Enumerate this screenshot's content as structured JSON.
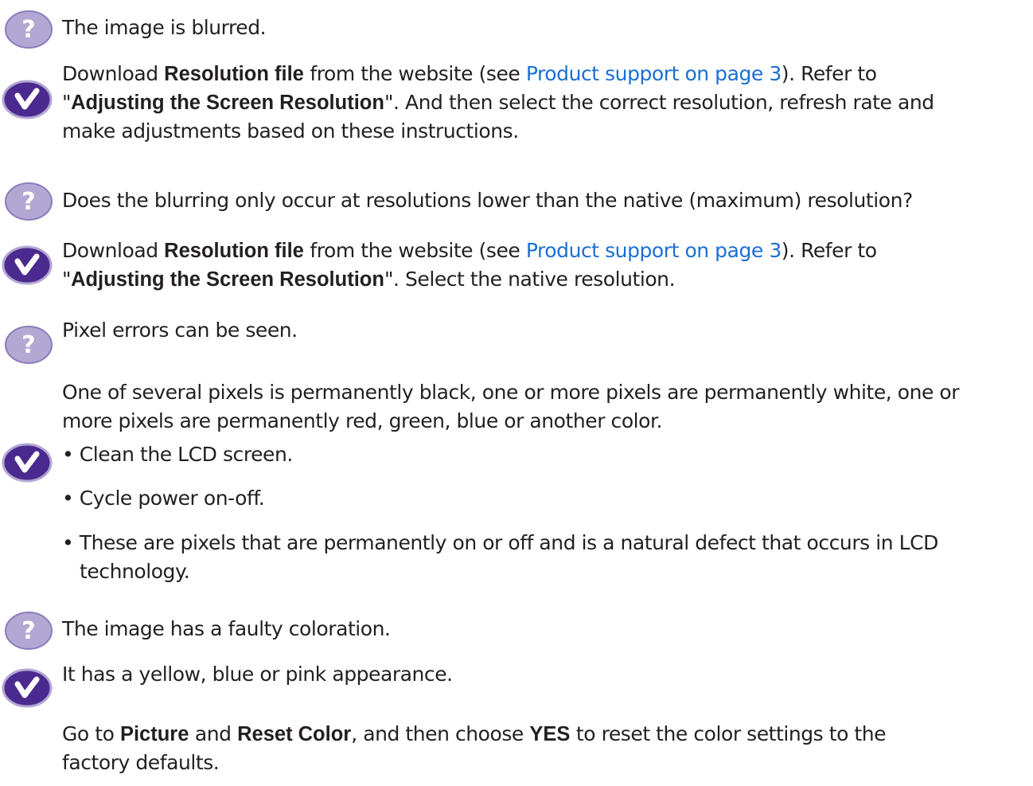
{
  "colors": {
    "question_icon_fill": "#b3a7d3",
    "question_icon_ring": "#8c7cbc",
    "check_icon_fill": "#4b2a8f",
    "check_icon_ring": "#b3a7d3",
    "link": "#1a6fd4",
    "text": "#231f20"
  },
  "icons": {
    "question": "question-mark-icon",
    "answer": "check-mark-icon"
  },
  "faq": {
    "q1": {
      "text": "The image is blurred."
    },
    "a1": {
      "t1": "Download ",
      "b1": "Resolution file",
      "t2": " from the website (see ",
      "link": "Product support on page 3",
      "t3": "). Refer to",
      "t4": "\"",
      "b2": "Adjusting the Screen Resolution",
      "t5": "\". And then select the correct resolution, refresh rate and",
      "t6": "make adjustments based on these instructions."
    },
    "q2": {
      "text": "Does the blurring only occur at resolutions lower than the native (maximum) resolution?"
    },
    "a2": {
      "t1": "Download ",
      "b1": "Resolution file",
      "t2": " from the website (see ",
      "link": "Product support on page 3",
      "t3": "). Refer to",
      "t4": "\"",
      "b2": "Adjusting the Screen Resolution",
      "t5": "\". Select the native resolution."
    },
    "q3": {
      "text": "Pixel errors can be seen."
    },
    "a3": {
      "intro_line1": "One of several pixels is permanently black, one or more pixels are permanently white, one or",
      "intro_line2": "more pixels are permanently red, green, blue or another color.",
      "bullet1": "• Clean the LCD screen.",
      "bullet2": "• Cycle power on-off.",
      "bullet3_line1": "• These are pixels that are permanently on or off and is a natural defect that occurs in LCD",
      "bullet3_line2": "technology."
    },
    "q4": {
      "text": "The image has a faulty coloration."
    },
    "a4": {
      "line1": "It has a yellow, blue or pink appearance.",
      "t1": "Go to ",
      "b1": "Picture",
      "t2": " and ",
      "b2": "Reset Color",
      "t3": ", and then choose ",
      "b3": "YES",
      "t4": " to reset the color settings to the",
      "t5": "factory defaults."
    }
  }
}
